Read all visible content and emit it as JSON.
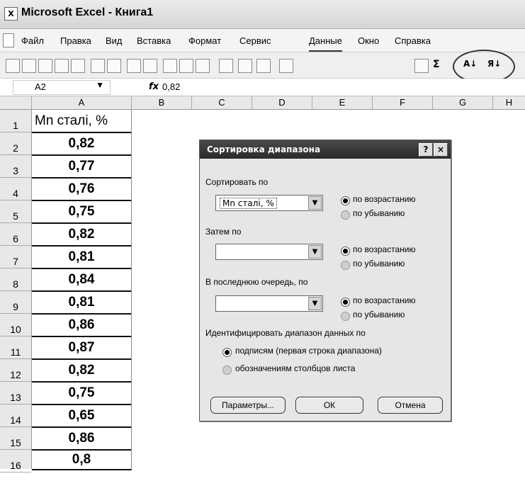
{
  "window": {
    "title": "Microsoft Excel - Книга1",
    "app_icon": "excel-icon"
  },
  "menu": [
    "Файл",
    "Правка",
    "Вид",
    "Вставка",
    "Формат",
    "Сервис",
    "Данные",
    "Окно",
    "Справка"
  ],
  "toolbar": {
    "sigma": "Σ",
    "sort_asc": "А↓",
    "sort_desc": "Я↓"
  },
  "formula_bar": {
    "name_box": "A2",
    "fx": "fx",
    "formula": "0,82"
  },
  "columns": [
    "A",
    "B",
    "C",
    "D",
    "E",
    "F",
    "G",
    "H"
  ],
  "rows": [
    "1",
    "2",
    "3",
    "4",
    "5",
    "6",
    "7",
    "8",
    "9",
    "10",
    "11",
    "12",
    "13",
    "14",
    "15",
    "16"
  ],
  "cells_A": [
    "Mn сталі, %",
    "0,82",
    "0,77",
    "0,76",
    "0,75",
    "0,82",
    "0,81",
    "0,84",
    "0,81",
    "0,86",
    "0,87",
    "0,82",
    "0,75",
    "0,65",
    "0,86",
    "0,8"
  ],
  "dialog": {
    "title": "Сортировка диапазона",
    "help_button": "?",
    "close_button": "×",
    "sort_by_label": "Сортировать по",
    "sort_by_value": "Mn сталі, %",
    "then_by_label": "Затем по",
    "then_by_value": "",
    "last_by_label": "В последнюю очередь, по",
    "last_by_value": "",
    "asc": "по возрастанию",
    "desc": "по убыванию",
    "identify_label": "Идентифицировать диапазон данных по",
    "by_labels": "подписям (первая строка диапазона)",
    "by_column_names": "обозначениям столбцов листа",
    "params_button": "Параметры...",
    "ok_button": "ОК",
    "cancel_button": "Отмена"
  }
}
